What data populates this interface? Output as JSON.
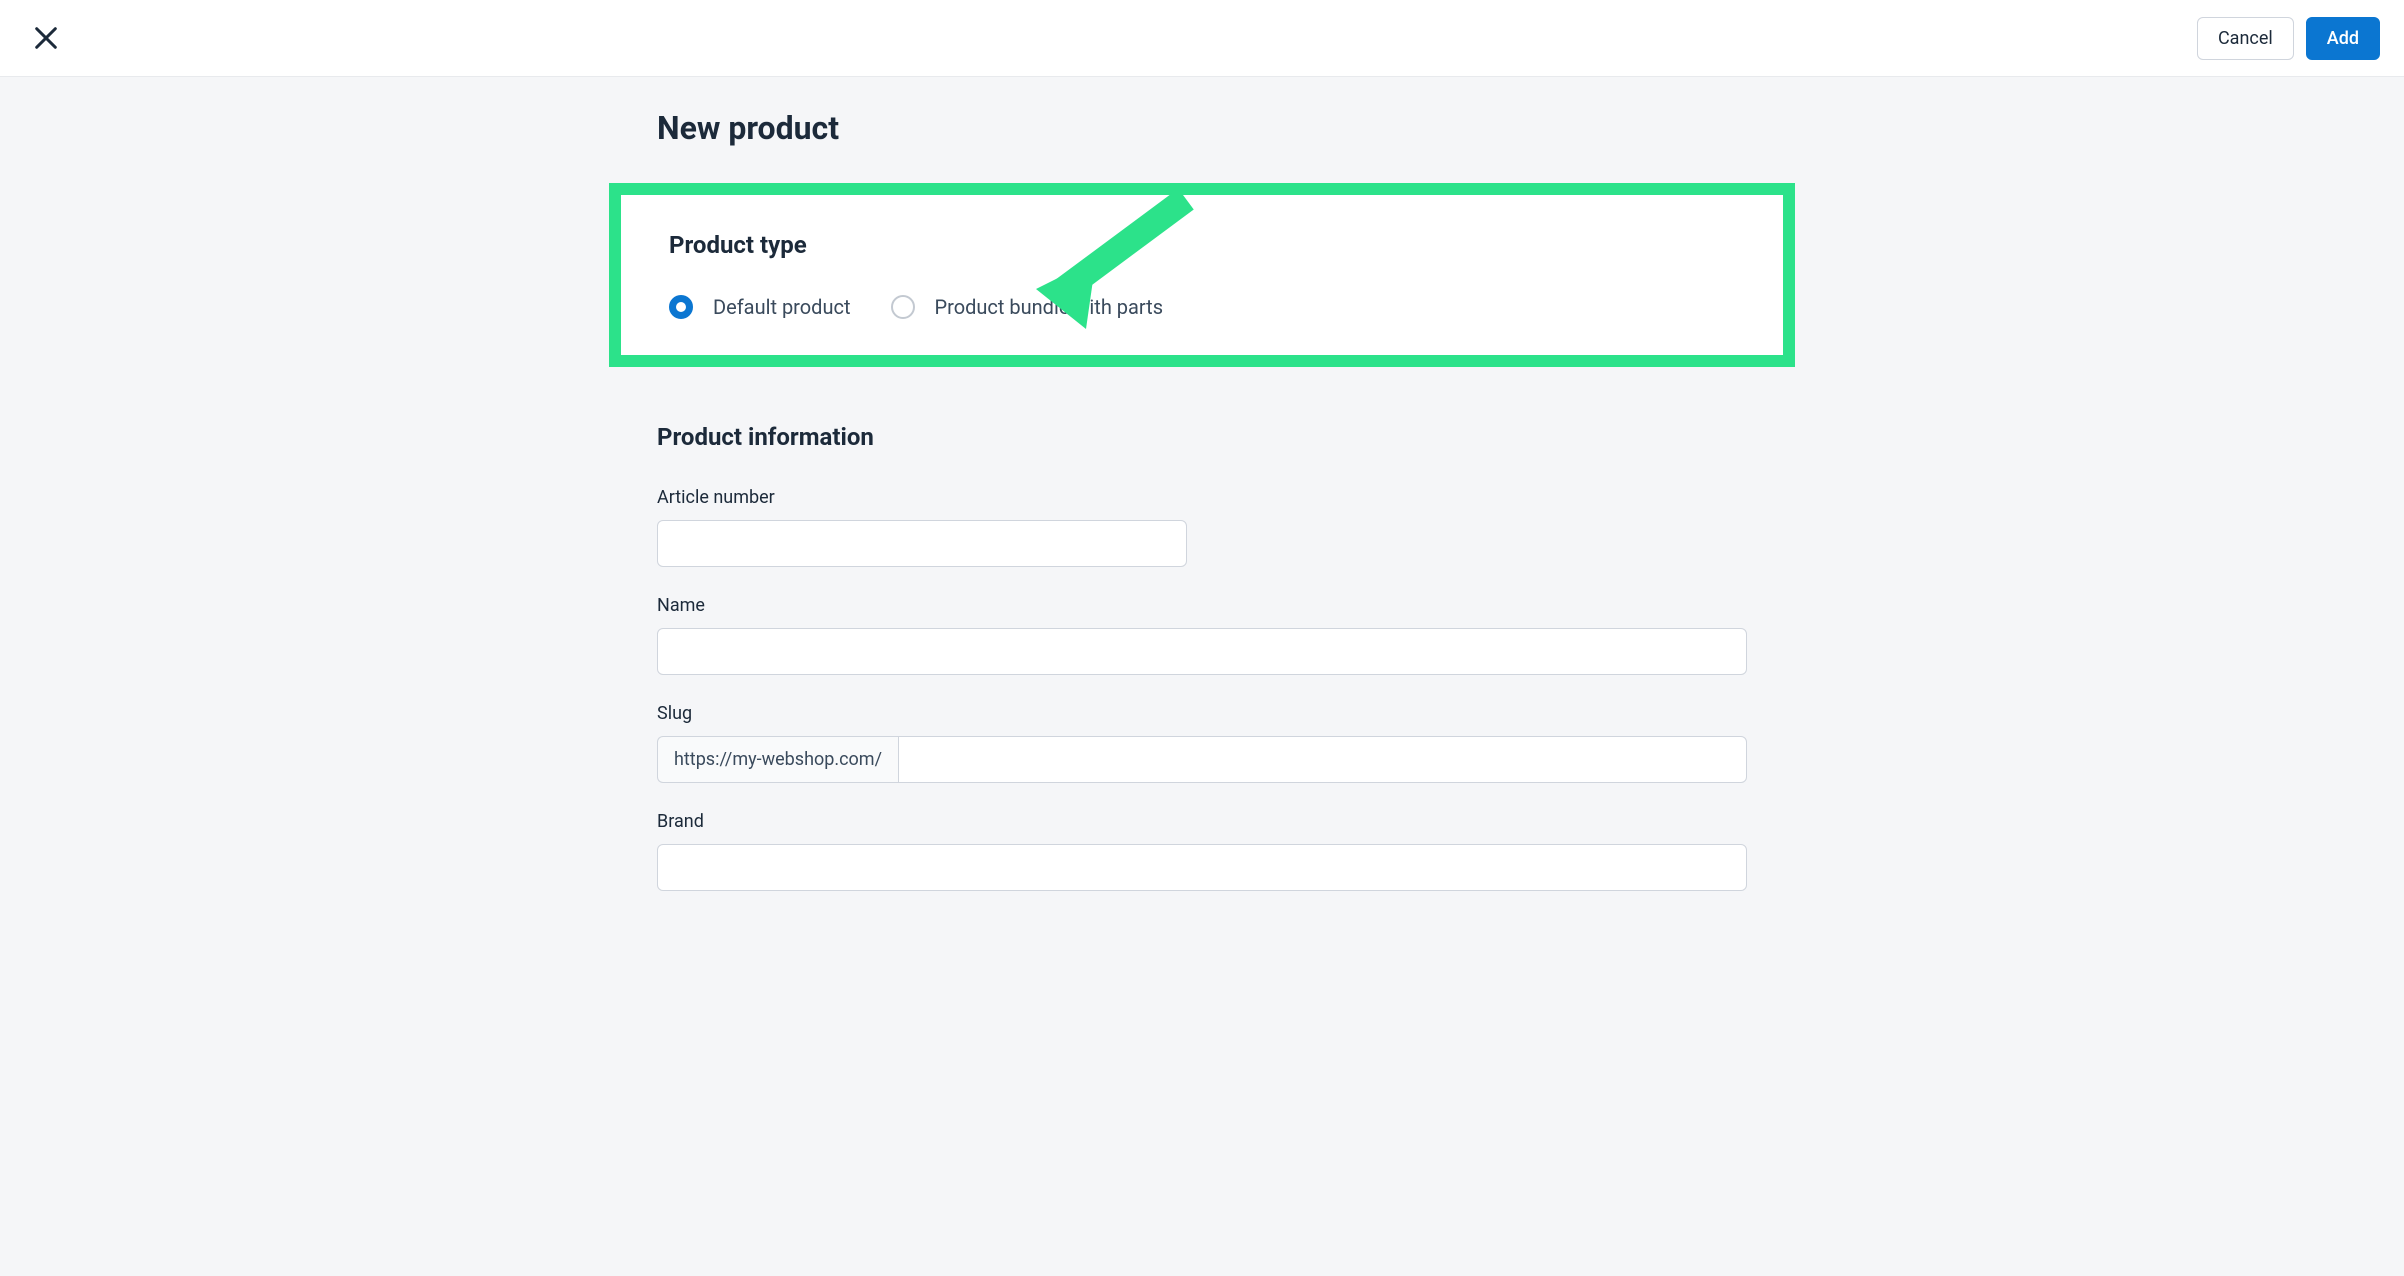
{
  "header": {
    "cancel_label": "Cancel",
    "add_label": "Add"
  },
  "page_title": "New product",
  "product_type": {
    "section_title": "Product type",
    "options": [
      {
        "label": "Default product",
        "checked": true
      },
      {
        "label": "Product bundle with parts",
        "checked": false
      }
    ]
  },
  "product_info": {
    "section_title": "Product information",
    "article_number_label": "Article number",
    "article_number_value": "",
    "name_label": "Name",
    "name_value": "",
    "slug_label": "Slug",
    "slug_prefix": "https://my-webshop.com/",
    "slug_value": "",
    "brand_label": "Brand"
  },
  "annotation": {
    "highlight_color": "#2ce28a",
    "arrow_target": "product-type-bundle"
  }
}
